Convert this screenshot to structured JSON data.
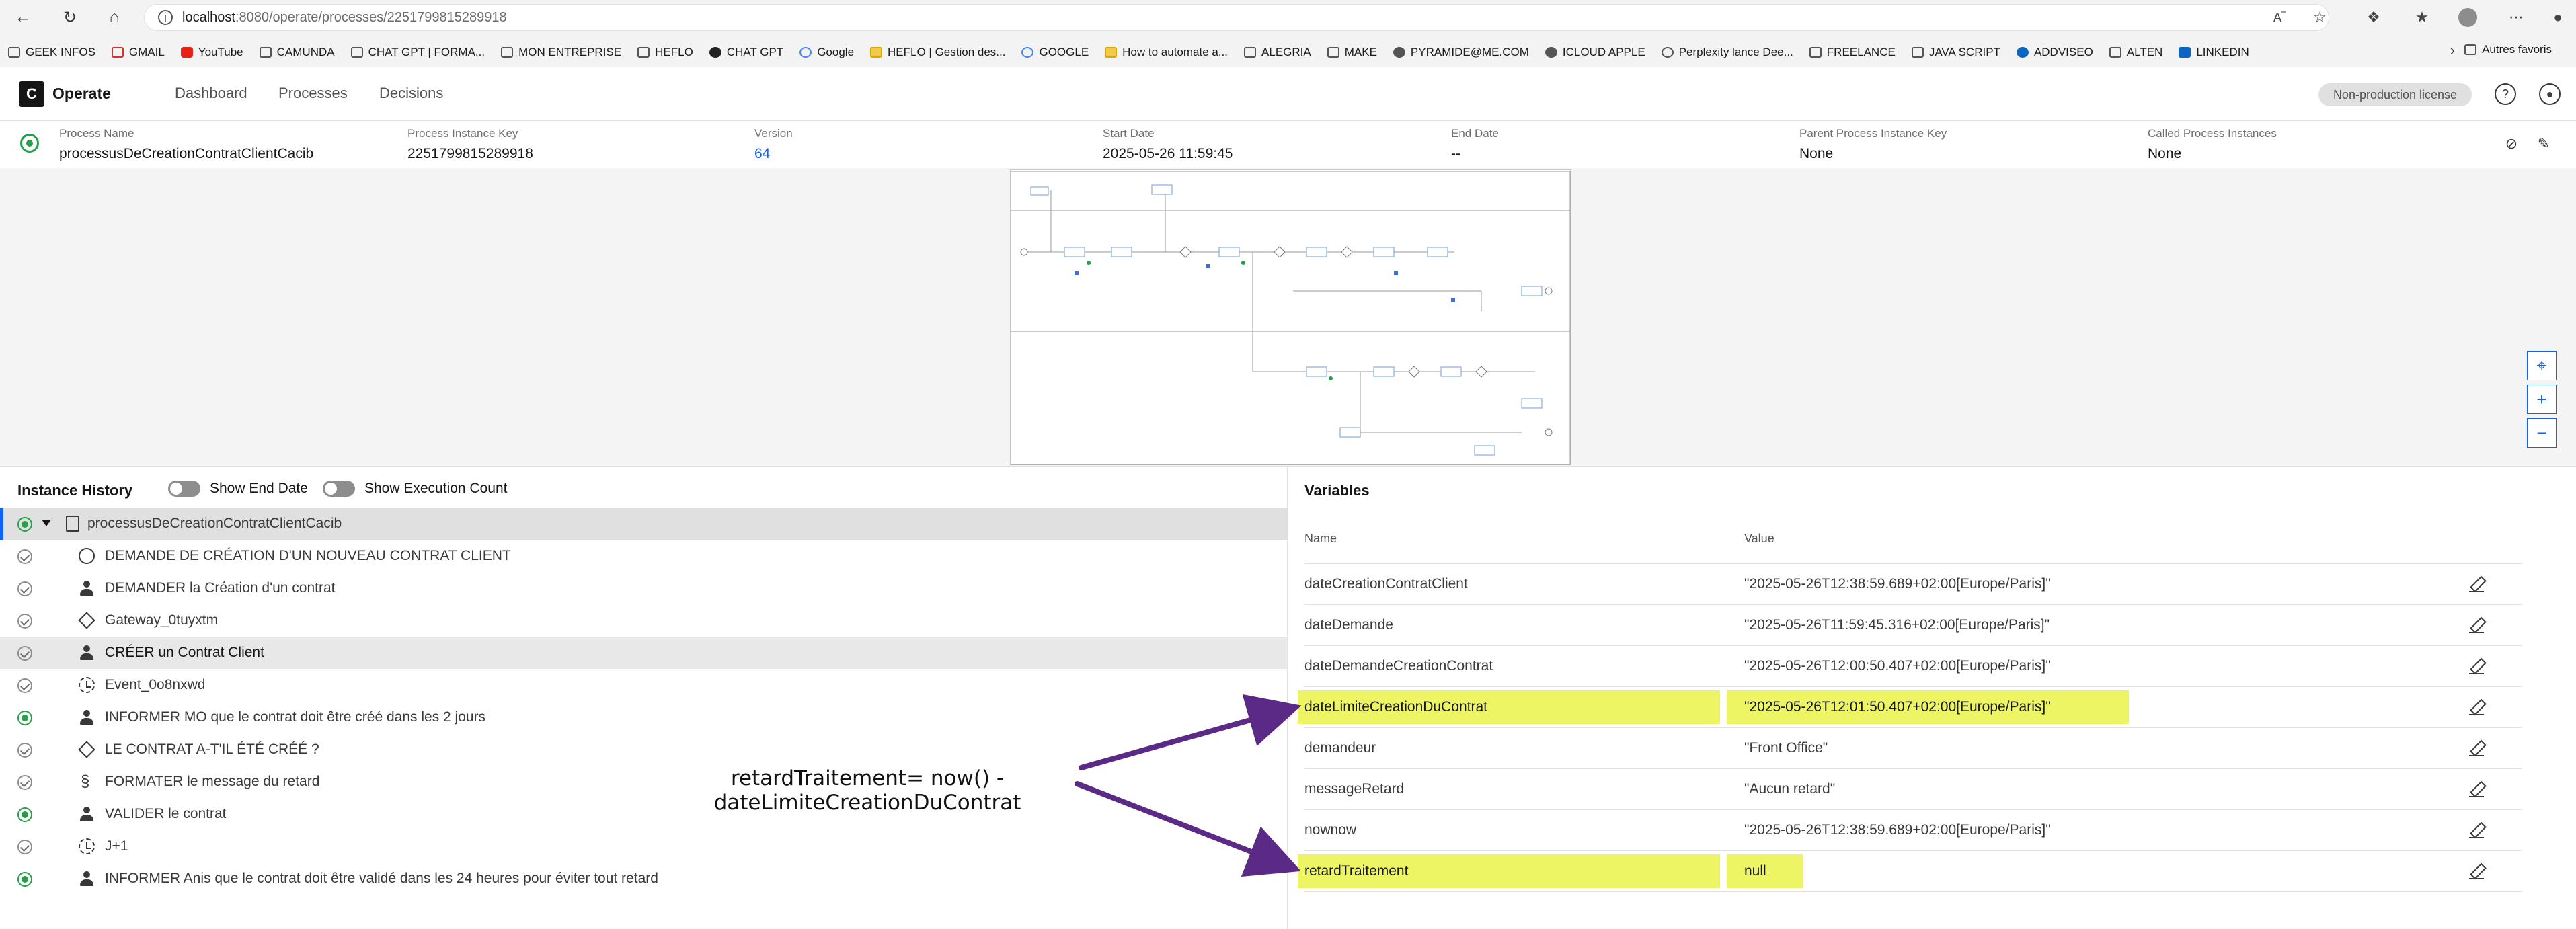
{
  "browser": {
    "url_host": "localhost",
    "url_path": ":8080/operate/processes/2251799815289918",
    "bookmarks": [
      {
        "label": "GEEK INFOS",
        "icon": "folder-icon"
      },
      {
        "label": "GMAIL",
        "icon": "gmail-icon"
      },
      {
        "label": "YouTube",
        "icon": "youtube-icon"
      },
      {
        "label": "CAMUNDA",
        "icon": "folder-icon"
      },
      {
        "label": "CHAT GPT | FORMA...",
        "icon": "folder-icon"
      },
      {
        "label": "MON ENTREPRISE",
        "icon": "folder-icon"
      },
      {
        "label": "HEFLO",
        "icon": "folder-icon"
      },
      {
        "label": "CHAT GPT",
        "icon": "openai-icon"
      },
      {
        "label": "Google",
        "icon": "google-icon"
      },
      {
        "label": "HEFLO | Gestion des...",
        "icon": "heflo-icon"
      },
      {
        "label": "GOOGLE",
        "icon": "google-icon"
      },
      {
        "label": "How to automate a...",
        "icon": "page-icon"
      },
      {
        "label": "ALEGRIA",
        "icon": "folder-icon"
      },
      {
        "label": "MAKE",
        "icon": "folder-icon"
      },
      {
        "label": "PYRAMIDE@ME.COM",
        "icon": "apple-icon"
      },
      {
        "label": "ICLOUD APPLE",
        "icon": "apple-icon"
      },
      {
        "label": "Perplexity lance Dee...",
        "icon": "globe-icon"
      },
      {
        "label": "FREELANCE",
        "icon": "folder-icon"
      },
      {
        "label": "JAVA SCRIPT",
        "icon": "folder-icon"
      },
      {
        "label": "ADDVISEO",
        "icon": "addviseo-icon"
      },
      {
        "label": "ALTEN",
        "icon": "folder-icon"
      },
      {
        "label": "LINKEDIN",
        "icon": "linkedin-icon"
      }
    ],
    "favorites_label": "Autres favoris"
  },
  "header": {
    "logo_letter": "C",
    "brand": "Operate",
    "nav": [
      "Dashboard",
      "Processes",
      "Decisions"
    ],
    "license": "Non-production license"
  },
  "summary": {
    "process_name_label": "Process Name",
    "process_name": "processusDeCreationContratClientCacib",
    "instance_key_label": "Process Instance Key",
    "instance_key": "2251799815289918",
    "version_label": "Version",
    "version": "64",
    "start_date_label": "Start Date",
    "start_date": "2025-05-26 11:59:45",
    "end_date_label": "End Date",
    "end_date": "--",
    "parent_key_label": "Parent Process Instance Key",
    "parent_key": "None",
    "called_label": "Called Process Instances",
    "called": "None"
  },
  "history": {
    "title": "Instance History",
    "toggle_end_date": "Show End Date",
    "toggle_exec_count": "Show Execution Count",
    "items": [
      {
        "label": "processusDeCreationContratClientCacib",
        "icon": "process-document-icon",
        "status": "active"
      },
      {
        "label": "DEMANDE DE CRÉATION D'UN NOUVEAU  CONTRAT CLIENT",
        "icon": "start-event-icon",
        "status": "completed"
      },
      {
        "label": "DEMANDER la Création d'un contrat",
        "icon": "user-task-icon",
        "status": "completed"
      },
      {
        "label": "Gateway_0tuyxtm",
        "icon": "gateway-icon",
        "status": "completed"
      },
      {
        "label": "CRÉER un Contrat Client",
        "icon": "user-task-icon",
        "status": "completed"
      },
      {
        "label": "Event_0o8nxwd",
        "icon": "timer-event-icon",
        "status": "completed"
      },
      {
        "label": "INFORMER MO que le contrat doit être créé dans les 2 jours",
        "icon": "user-task-icon",
        "status": "active"
      },
      {
        "label": "LE CONTRAT A-T'IL ÉTÉ CRÉÉ ?",
        "icon": "gateway-icon",
        "status": "completed"
      },
      {
        "label": "FORMATER le message du retard",
        "icon": "script-task-icon",
        "status": "completed"
      },
      {
        "label": "VALIDER le contrat",
        "icon": "user-task-icon",
        "status": "active"
      },
      {
        "label": "J+1",
        "icon": "timer-event-icon",
        "status": "completed"
      },
      {
        "label": "INFORMER Anis que le contrat doit être validé dans les 24 heures pour éviter tout retard",
        "icon": "user-task-icon",
        "status": "active"
      }
    ]
  },
  "variables": {
    "title": "Variables",
    "col_name": "Name",
    "col_value": "Value",
    "rows": [
      {
        "name": "dateCreationContratClient",
        "value": "\"2025-05-26T12:38:59.689+02:00[Europe/Paris]\""
      },
      {
        "name": "dateDemande",
        "value": "\"2025-05-26T11:59:45.316+02:00[Europe/Paris]\""
      },
      {
        "name": "dateDemandeCreationContrat",
        "value": "\"2025-05-26T12:00:50.407+02:00[Europe/Paris]\""
      },
      {
        "name": "dateLimiteCreationDuContrat",
        "value": "\"2025-05-26T12:01:50.407+02:00[Europe/Paris]\""
      },
      {
        "name": "demandeur",
        "value": "\"Front Office\""
      },
      {
        "name": "messageRetard",
        "value": "\"Aucun retard\""
      },
      {
        "name": "nownow",
        "value": "\"2025-05-26T12:38:59.689+02:00[Europe/Paris]\""
      },
      {
        "name": "retardTraitement",
        "value": "null"
      }
    ]
  },
  "annotation": {
    "line1": "retardTraitement= now() -",
    "line2": "dateLimiteCreationDuContrat"
  },
  "colors": {
    "highlight": "#eef564",
    "arrow": "#5b2a86",
    "primary_blue": "#0f62fe",
    "success_green": "#24a148"
  }
}
